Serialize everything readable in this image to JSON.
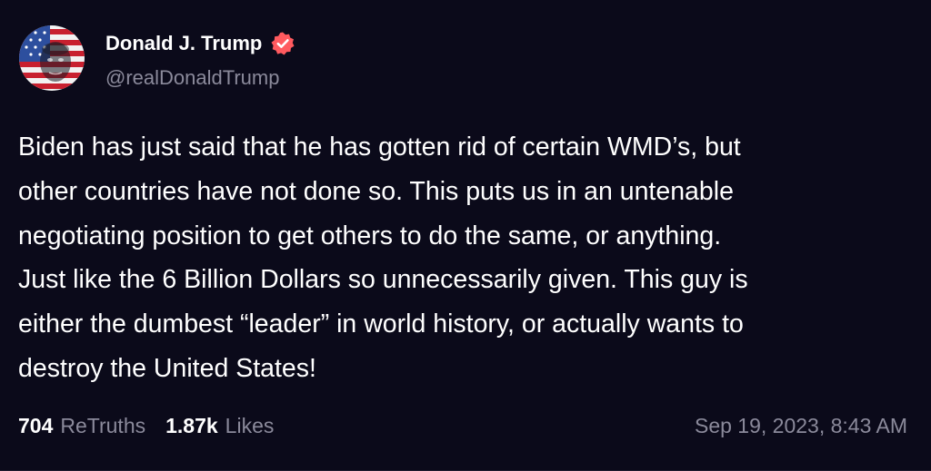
{
  "author": {
    "display_name": "Donald J. Trump",
    "handle": "@realDonaldTrump",
    "avatar_icon": "flag-portrait-avatar",
    "verified_icon": "verified-badge-icon",
    "verified_color": "#ff5a5f"
  },
  "post": {
    "lines": [
      "Biden has just said that he has gotten rid of certain WMD’s, but",
      "other countries have not done so. This puts us in an untenable",
      "negotiating position to get others to do the same, or anything.",
      "Just like the 6 Billion Dollars so unnecessarily given. This guy is",
      "either the dumbest “leader” in world history, or actually wants to",
      "destroy the United States!"
    ]
  },
  "stats": {
    "retruths_count": "704",
    "retruths_label": "ReTruths",
    "likes_count": "1.87k",
    "likes_label": "Likes"
  },
  "timestamp": "Sep 19, 2023, 8:43 AM",
  "colors": {
    "background": "#0b0a1a",
    "text": "#ffffff",
    "muted": "#8b8a9b"
  }
}
